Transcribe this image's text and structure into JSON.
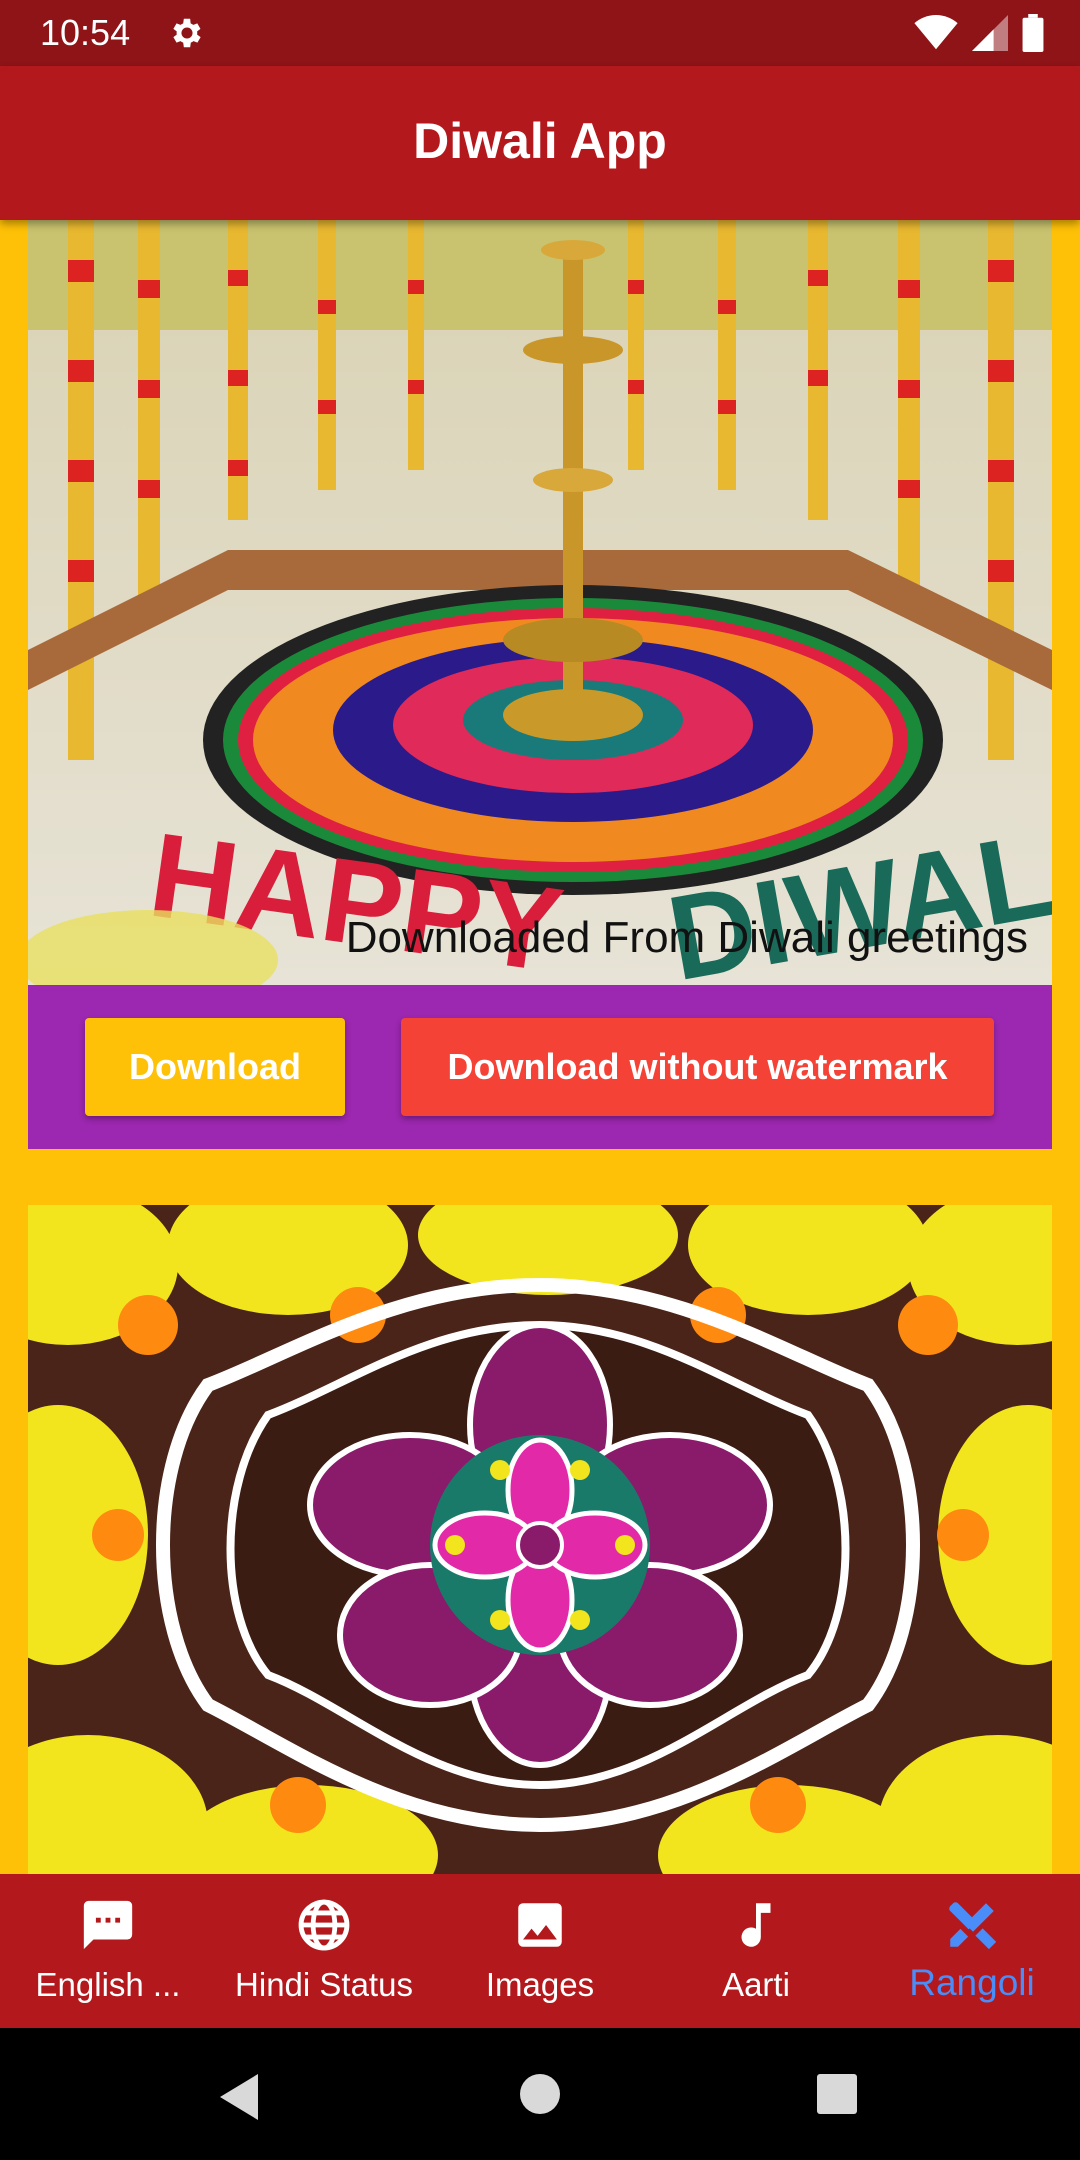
{
  "status_bar": {
    "time": "10:54",
    "icons": [
      "gear-icon",
      "wifi-icon",
      "signal-icon",
      "battery-icon"
    ]
  },
  "app_bar": {
    "title": "Diwali App"
  },
  "cards": [
    {
      "image": "rangoli-with-brass-lamp",
      "watermark": "Downloaded From Diwali greetings",
      "download_label": "Download",
      "download_no_watermark_label": "Download without watermark"
    },
    {
      "image": "flower-rangoli"
    }
  ],
  "bottom_nav": {
    "items": [
      {
        "label": "English ...",
        "icon": "message-icon"
      },
      {
        "label": "Hindi Status",
        "icon": "globe-icon"
      },
      {
        "label": "Images",
        "icon": "image-icon"
      },
      {
        "label": "Aarti",
        "icon": "music-note-icon"
      },
      {
        "label": "Rangoli",
        "icon": "rangoli-tools-icon",
        "active": true
      }
    ]
  },
  "colors": {
    "app_bar": "#b3191c",
    "status_bar": "#8e1418",
    "content_bg": "#ffc107",
    "action_panel": "#9c27b0",
    "download_button": "#ffc107",
    "download_no_watermark_button": "#f44336",
    "nav_active": "#4a8df8"
  }
}
